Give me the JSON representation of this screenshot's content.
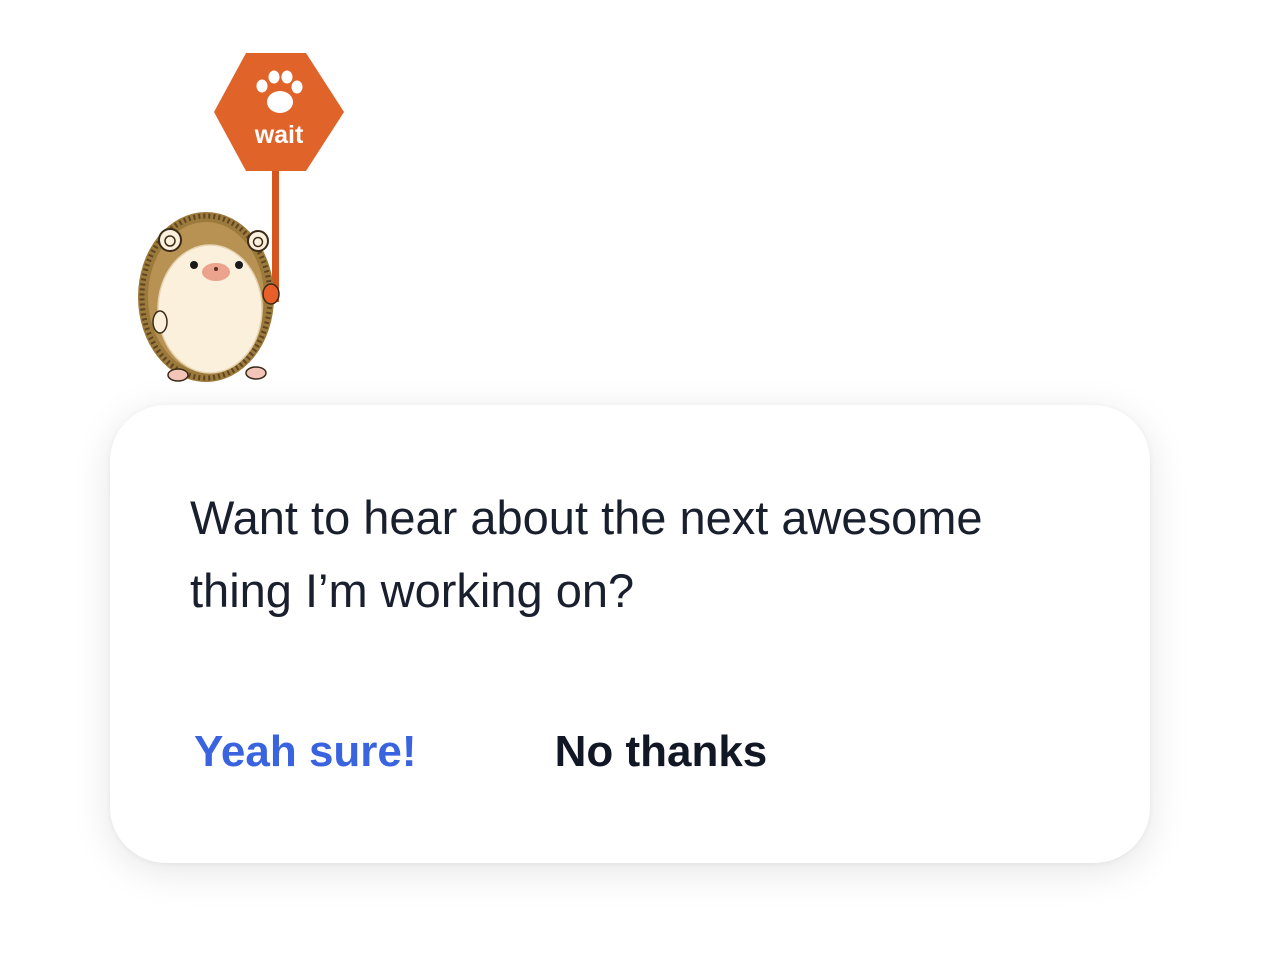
{
  "mascot": {
    "icon": "hedgehog-holding-sign",
    "sign_text": "wait",
    "sign_icon": "paw-print-icon",
    "sign_color": "#e0632a"
  },
  "dialog": {
    "message": "Want to hear about the next awesome thing I’m working on?",
    "confirm_label": "Yeah sure!",
    "decline_label": "No thanks"
  },
  "colors": {
    "confirm": "#3a63e0",
    "decline": "#121726",
    "text": "#1a1f2e"
  }
}
